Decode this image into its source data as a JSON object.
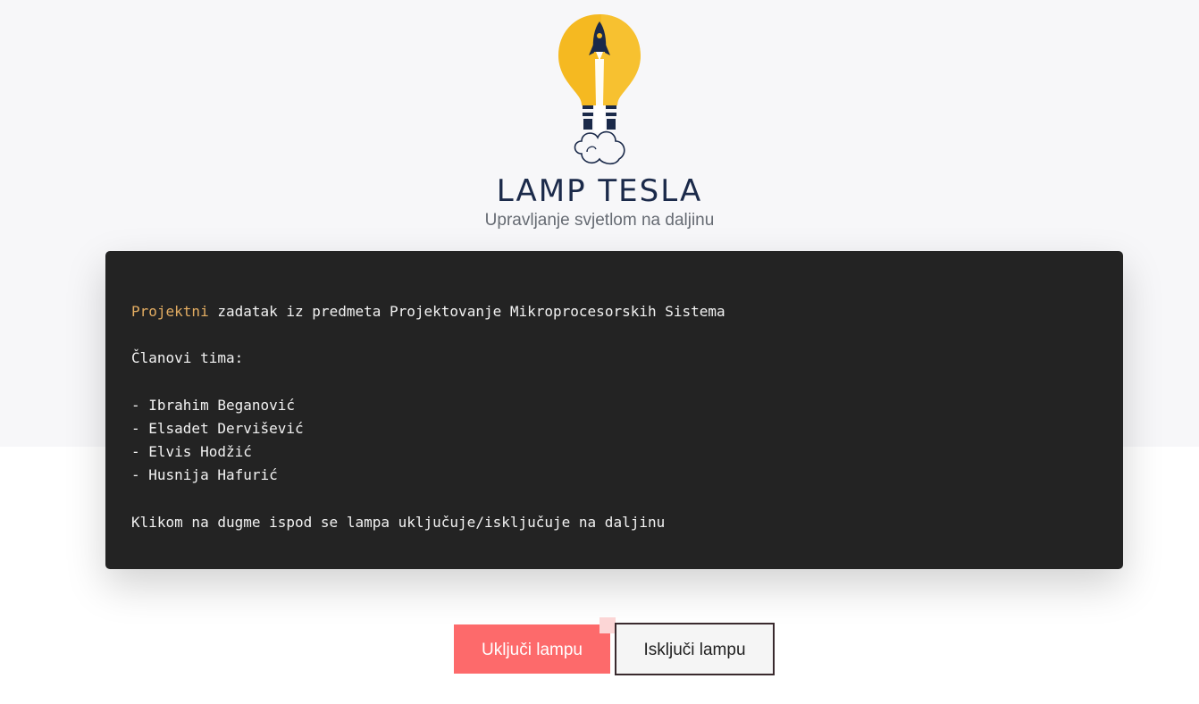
{
  "brand": {
    "title": "LAMP TESLA",
    "subtitle": "Upravljanje svjetlom na daljinu",
    "logo": "lightbulb-rocket-logo",
    "colors": {
      "bulb": "#f5b921",
      "navy": "#1b2a4a"
    }
  },
  "code": {
    "line1_keyword": "Projektni",
    "line1_rest": " zadatak iz predmeta Projektovanje Mikroprocesorskih Sistema",
    "team_heading": "Članovi tima:",
    "members": [
      "- Ibrahim Beganović",
      "- Elsadet Dervišević",
      "- Elvis Hodžić",
      "- Husnija Hafurić"
    ],
    "instruction": "Klikom na dugme ispod se lampa uključuje/isključuje na daljinu",
    "colors": {
      "background": "#232323",
      "keyword": "#e3ad62",
      "text": "#f2f2f2"
    }
  },
  "buttons": {
    "on_label": "Uključi lampu",
    "off_label": "Isključi lampu",
    "on_color": "#fd6a6b"
  }
}
